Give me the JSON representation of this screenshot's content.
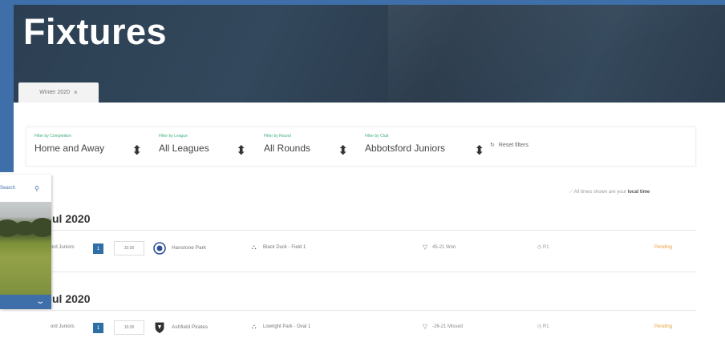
{
  "header": {
    "title": "Fixtures",
    "season_tab": {
      "label": "Winter 2020",
      "close": "×"
    }
  },
  "filters": {
    "competition": {
      "label": "Filter by Competition",
      "value": "Home and Away"
    },
    "league": {
      "label": "Filter by League",
      "value": "All Leagues"
    },
    "round": {
      "label": "Filter by Round",
      "value": "All Rounds"
    },
    "club": {
      "label": "Filter by Club",
      "value": "Abbotsford Juniors"
    },
    "reset_label": "Reset filters"
  },
  "timezone_note": {
    "text": "All times shown are your",
    "link": "local time"
  },
  "dates": [
    {
      "label": "ul 2020"
    },
    {
      "label": "ul 2020"
    }
  ],
  "fixtures": [
    {
      "team": "ord Juniors",
      "number": "1",
      "time": "10:30",
      "opponent": "Hanstone Park",
      "venue": "Black Duck - Field 1",
      "result": "45-21 Won",
      "round": "R1",
      "status": "Pending"
    },
    {
      "team": "ord Juniors",
      "number": "1",
      "time": "10:30",
      "opponent": "Ashfield Pirates",
      "venue": "Lowright Park - Oval 1",
      "result": "-26-21 Missed",
      "round": "R1",
      "status": "Pending"
    }
  ],
  "overlay": {
    "search_label": "Search"
  },
  "colors": {
    "accent_blue": "#3f6fa8",
    "filter_label_green": "#3fae7a",
    "status_orange": "#e8a23a",
    "hero_dark": "#2e4154"
  }
}
